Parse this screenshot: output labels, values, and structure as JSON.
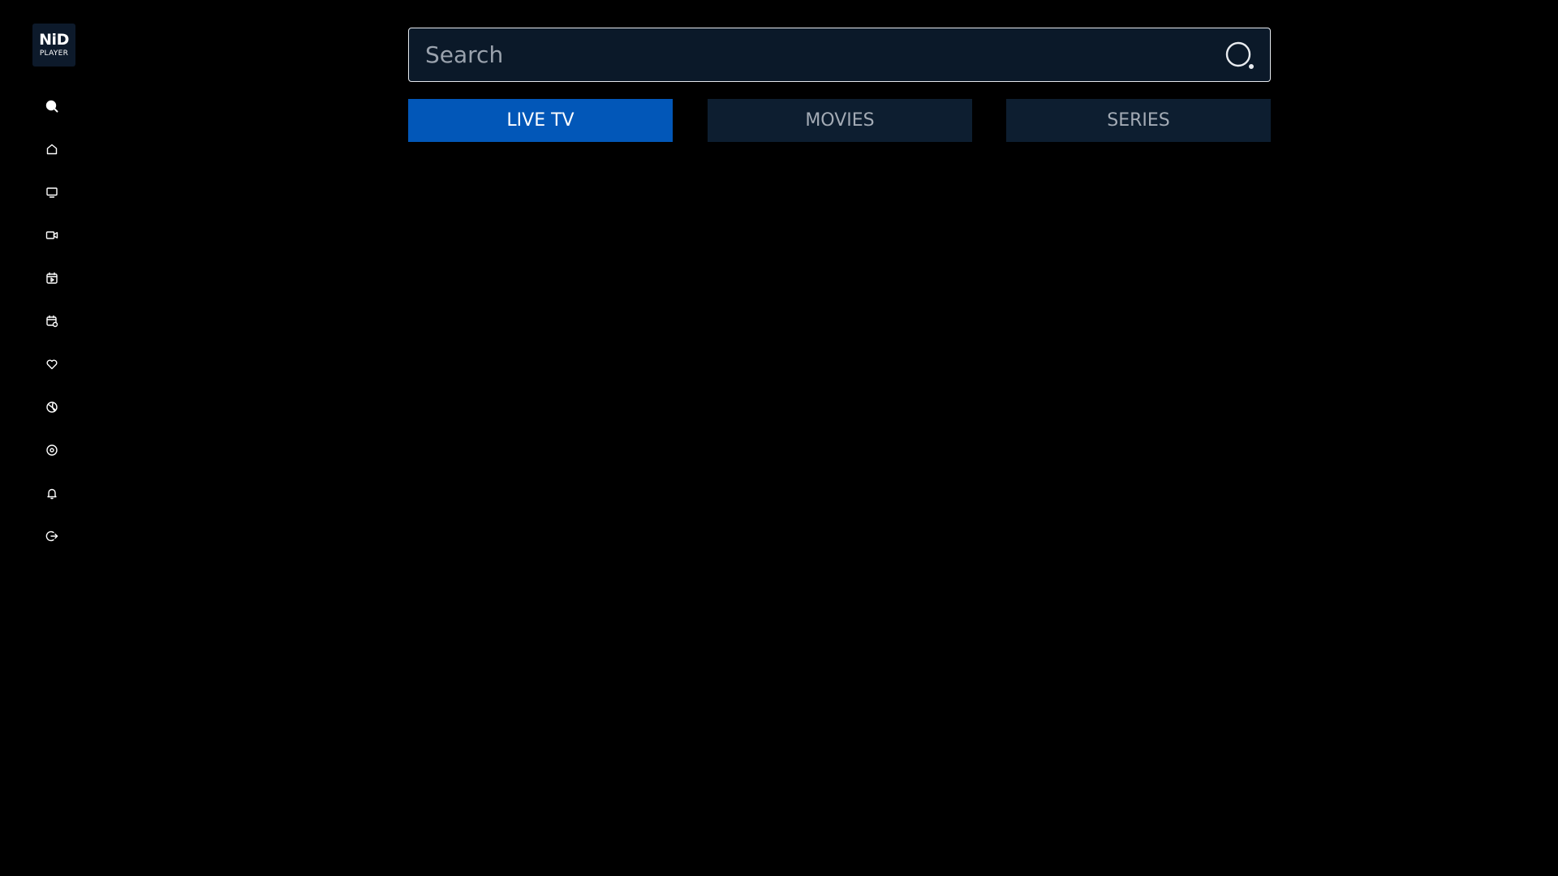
{
  "logo": {
    "line1": "NiD",
    "line2": "PLAYER"
  },
  "sidebar": {
    "items": [
      {
        "icon": "search-icon",
        "active": true
      },
      {
        "icon": "home-icon"
      },
      {
        "icon": "tv-icon"
      },
      {
        "icon": "video-camera-icon"
      },
      {
        "icon": "calendar-play-icon"
      },
      {
        "icon": "calendar-settings-icon"
      },
      {
        "icon": "heart-icon"
      },
      {
        "icon": "sports-ball-icon"
      },
      {
        "icon": "settings-icon"
      },
      {
        "icon": "bell-icon"
      },
      {
        "icon": "logout-icon"
      }
    ]
  },
  "search": {
    "placeholder": "Search",
    "value": ""
  },
  "tabs": [
    {
      "label": "LIVE TV",
      "active": true
    },
    {
      "label": "MOVIES",
      "active": false
    },
    {
      "label": "SERIES",
      "active": false
    }
  ],
  "colors": {
    "background": "#000000",
    "accent": "#0257b8",
    "tab_inactive": "#0d1e30",
    "search_bg": "#0b1929"
  }
}
